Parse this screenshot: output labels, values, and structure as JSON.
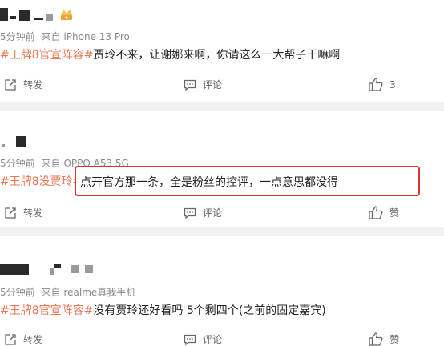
{
  "posts": [
    {
      "time": "5分钟前",
      "source": "来自 iPhone 13 Pro",
      "tag": "#王牌8官宣阵容#",
      "text": "贾玲不来，让谢娜来啊，你请这么一大帮子干嘛啊",
      "repost": "转发",
      "comment": "评论",
      "like": "3"
    },
    {
      "time": "5分钟前",
      "source": "来自 OPPO A53 5G",
      "tag": "#王牌8没贾玲#",
      "text": "点开官方那一条，全是粉丝的控评，一点意思都没得",
      "repost": "转发",
      "comment": "评论",
      "like": "赞"
    },
    {
      "time": "5分钟前",
      "source": "来自 realme真我手机",
      "tag": "#王牌8官宣阵容#",
      "text": "没有贾玲还好看吗 5个剩四个(之前的固定嘉宾)",
      "repost": "转发",
      "comment": "评论",
      "like": "赞"
    }
  ],
  "colors": {
    "tag": "#eb7350",
    "highlight_border": "#d9362b",
    "separator": "#f2f2f2"
  },
  "icons": {
    "repost": "repost-icon",
    "comment": "comment-icon",
    "like": "thumbs-up-icon",
    "badge": "crown-icon"
  }
}
